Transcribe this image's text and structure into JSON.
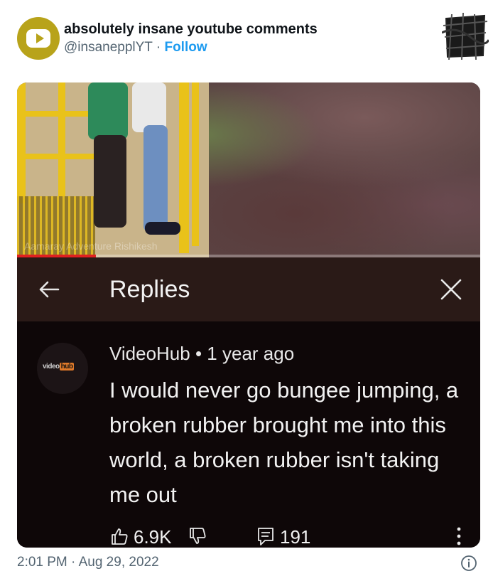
{
  "tweet": {
    "display_name": "absolutely insane youtube comments",
    "handle": "@insanepplYT",
    "separator": " · ",
    "follow_label": "Follow",
    "timestamp": "2:01 PM · Aug 29, 2022",
    "avatar_icon": "youtube-play-icon",
    "accent_color": "#1d9bf0"
  },
  "embedded": {
    "video_watermark": "Aamaray Adventure Rishikesh",
    "video_progress": 0.17,
    "replies_header": {
      "title": "Replies",
      "back_icon": "arrow-left-icon",
      "close_icon": "close-x-icon"
    },
    "comment": {
      "channel_logo_prefix": "video",
      "channel_logo_suffix": "hub",
      "author": "VideoHub",
      "dot": " • ",
      "age": "1 year ago",
      "text": "I would never go bungee jumping, a broken rubber brought me into this world, a broken rubber isn't taking me out",
      "likes": "6.9K",
      "replies": "191",
      "like_icon": "thumbs-up-icon",
      "dislike_icon": "thumbs-down-icon",
      "reply_icon": "comment-icon",
      "more_icon": "vertical-dots-icon"
    }
  },
  "footer": {
    "info_icon": "info-circle-icon"
  }
}
